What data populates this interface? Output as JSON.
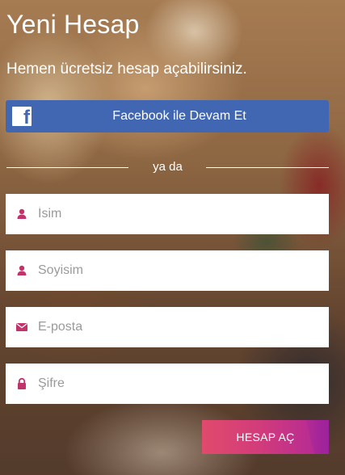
{
  "header": {
    "title": "Yeni Hesap",
    "subtitle": "Hemen ücretsiz hesap açabilirsiniz."
  },
  "facebook": {
    "label": "Facebook ile Devam Et",
    "icon": "facebook-icon",
    "color": "#4267b2"
  },
  "divider": {
    "text": "ya da"
  },
  "form": {
    "fields": [
      {
        "placeholder": "İsim",
        "icon": "user-icon",
        "value": ""
      },
      {
        "placeholder": "Soyisim",
        "icon": "user-icon",
        "value": ""
      },
      {
        "placeholder": "E-posta",
        "icon": "envelope-icon",
        "value": ""
      },
      {
        "placeholder": "Şifre",
        "icon": "lock-icon",
        "value": ""
      }
    ],
    "icon_color": "#c2336b",
    "submit_label": "HESAP AÇ"
  }
}
